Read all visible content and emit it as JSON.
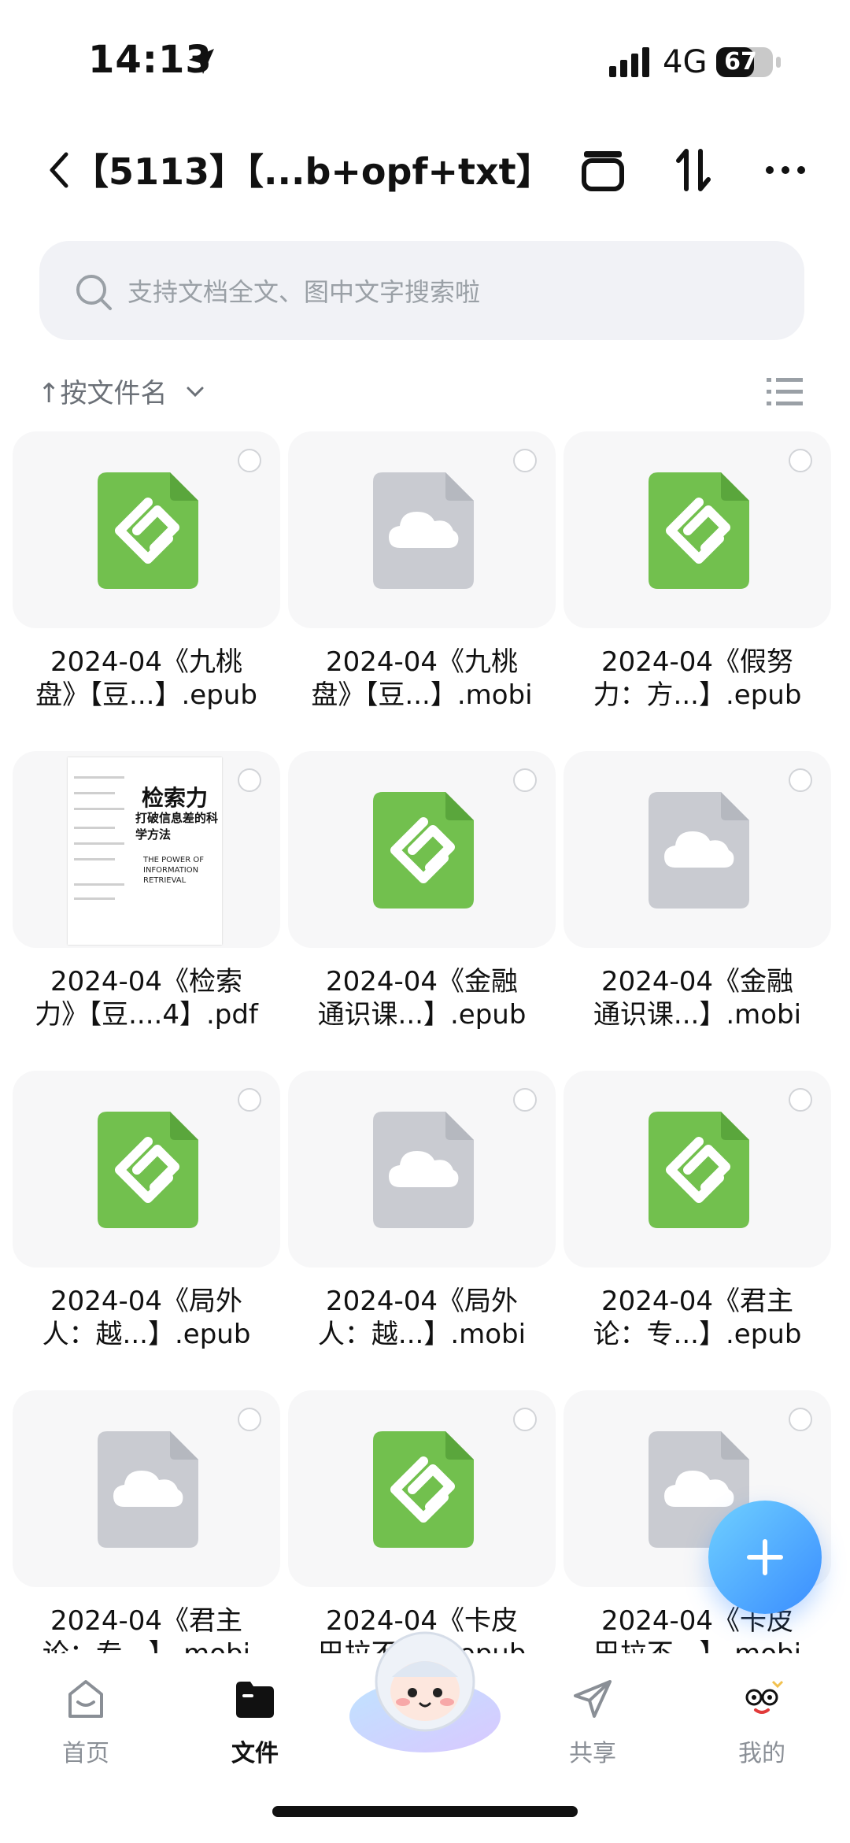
{
  "status": {
    "time": "14:13",
    "network": "4G",
    "battery": "67",
    "battery_level": 0.67
  },
  "header": {
    "title": "【5113】【...b+opf+txt】"
  },
  "search": {
    "placeholder": "支持文档全文、图中文字搜索啦"
  },
  "sort": {
    "label": "↑按文件名"
  },
  "files": [
    {
      "line1": "2024-04《九桃",
      "line2": "盘》【豆...】.epub",
      "type": "epub"
    },
    {
      "line1": "2024-04《九桃",
      "line2": "盘》【豆...】.mobi",
      "type": "mobi"
    },
    {
      "line1": "2024-04《假努",
      "line2": "力：方...】.epub",
      "type": "epub"
    },
    {
      "line1": "2024-04《检索",
      "line2": "力》【豆....4】.pdf",
      "type": "pdf"
    },
    {
      "line1": "2024-04《金融",
      "line2": "通识课...】.epub",
      "type": "epub"
    },
    {
      "line1": "2024-04《金融",
      "line2": "通识课...】.mobi",
      "type": "mobi"
    },
    {
      "line1": "2024-04《局外",
      "line2": "人：越...】.epub",
      "type": "epub"
    },
    {
      "line1": "2024-04《局外",
      "line2": "人：越...】.mobi",
      "type": "mobi"
    },
    {
      "line1": "2024-04《君主",
      "line2": "论：专...】.epub",
      "type": "epub"
    },
    {
      "line1": "2024-04《君主",
      "line2": "论：专...】.mobi",
      "type": "mobi"
    },
    {
      "line1": "2024-04《卡皮",
      "line2": "巴拉不...】.epub",
      "type": "epub"
    },
    {
      "line1": "2024-04《卡皮",
      "line2": "巴拉不...】.mobi",
      "type": "mobi"
    }
  ],
  "pdf_cover": {
    "title": "检索力",
    "subtitle": "打破信息差的科学方法",
    "english": "THE POWER OF INFORMATION RETRIEVAL"
  },
  "nav": [
    {
      "label": "首页",
      "icon": "home-icon",
      "active": false
    },
    {
      "label": "文件",
      "icon": "folder-icon",
      "active": true
    },
    {
      "label": "",
      "icon": "mascot-icon",
      "active": false
    },
    {
      "label": "共享",
      "icon": "share-icon",
      "active": false
    },
    {
      "label": "我的",
      "icon": "profile-icon",
      "active": false
    }
  ],
  "colors": {
    "epub": "#72c04e",
    "mobi": "#c9cbd1",
    "accent": "#3a8dff"
  }
}
